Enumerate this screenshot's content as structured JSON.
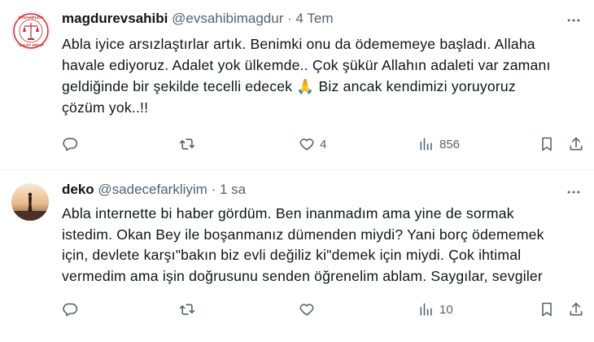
{
  "tweets": [
    {
      "author_name": "magdurevsahibi",
      "author_handle": "@evsahibimagdur",
      "separator": "·",
      "time": "4 Tem",
      "avatar_text_top": "EVSAHİPLERİ",
      "avatar_text_bottom": "ADALET ARIYOR",
      "lines": [
        "Abla iyice arsızlaştırlar artık. Benimki onu da ödememeye başladı. Allaha",
        "havale ediyoruz. Adalet yok ülkemde.. Çok şükür Allahın adaleti var zamanı",
        "geldiğinde bir şekilde tecelli edecek 🙏 Biz ancak kendimizi yoruyoruz",
        "çözüm yok..!!"
      ],
      "reply_count": "",
      "retweet_count": "",
      "like_count": "4",
      "view_count": "856"
    },
    {
      "author_name": "deko",
      "author_handle": "@sadecefarkliyim",
      "separator": "·",
      "time": "1 sa",
      "lines": [
        "Abla internette bi haber gördüm. Ben inanmadım ama yine de sormak",
        "istedim. Okan Bey ile boşanmanız dümenden miydi? Yani borç ödememek",
        "için, devlete karşı\"bakın biz evli değiliz ki\"demek için miydi. Çok ihtimal",
        "vermedim ama işin doğrusunu senden öğrenelim ablam. Saygılar, sevgiler"
      ],
      "reply_count": "",
      "retweet_count": "",
      "like_count": "",
      "view_count": "10"
    }
  ],
  "icons": {
    "more": "more-horizontal-icon",
    "reply": "reply-icon",
    "retweet": "retweet-icon",
    "like": "heart-icon",
    "views": "views-chart-icon",
    "bookmark": "bookmark-icon",
    "share": "share-icon"
  },
  "colors": {
    "text": "#0f1419",
    "secondary": "#536471",
    "divider": "#eff3f4",
    "avatar_red": "#c62828"
  }
}
